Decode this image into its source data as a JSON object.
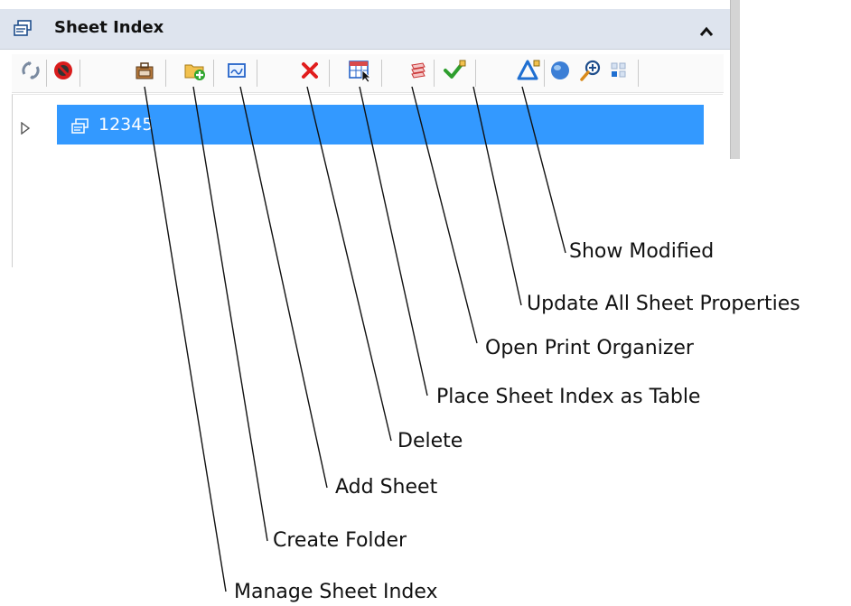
{
  "panel": {
    "title": "Sheet Index",
    "tree_item": "12345"
  },
  "icons": [
    "sheet-index-icon",
    "collapse-chevron-icon",
    "refresh-icon",
    "no-entry-icon",
    "manage-sheet-index-icon",
    "create-folder-icon",
    "add-sheet-icon",
    "delete-icon",
    "place-table-icon",
    "print-organizer-icon",
    "update-properties-icon",
    "show-modified-icon",
    "globe-icon",
    "zoom-icon",
    "grid-icon",
    "expand-arrow-icon"
  ],
  "callouts": {
    "manage_sheet_index": "Manage Sheet Index",
    "create_folder": "Create Folder",
    "add_sheet": "Add Sheet",
    "delete": "Delete",
    "place_table": "Place Sheet Index as Table",
    "open_print_organizer": "Open Print Organizer",
    "update_all": "Update All Sheet Properties",
    "show_modified": "Show Modified"
  },
  "colors": {
    "header_bg": "#dee4ee",
    "selection": "#3399ff",
    "delete_red": "#e11d1d",
    "check_green": "#2e9e2e"
  }
}
